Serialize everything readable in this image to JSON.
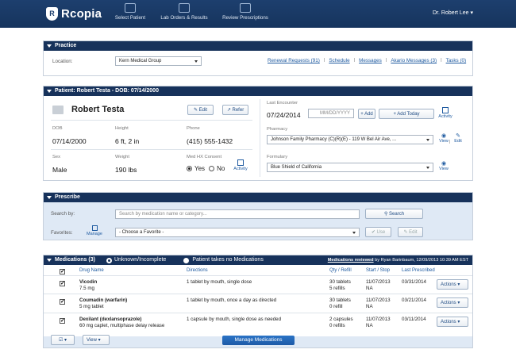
{
  "app": {
    "name": "Rcopia",
    "logo_letter": "R"
  },
  "nav": {
    "select_patient": "Select Patient",
    "lab_orders": "Lab Orders & Results",
    "review_rx": "Review Prescriptions",
    "user": "Dr. Robert Lee ▾"
  },
  "practice": {
    "header": "Practice",
    "location_label": "Location:",
    "location_value": "Kern Medical Group",
    "links": [
      "Renewal Requests (91)",
      "Schedule",
      "Messages",
      "Akario Messages (3)",
      "Tasks (0)"
    ]
  },
  "patient": {
    "header": "Patient: Robert Testa - DOB: 07/14/2000",
    "name": "Robert Testa",
    "edit": "Edit",
    "refer": "Refer",
    "dob_label": "DOB",
    "dob": "07/14/2000",
    "height_label": "Height",
    "height": "6 ft, 2 in",
    "phone_label": "Phone",
    "phone": "(415) 555-1432",
    "sex_label": "Sex",
    "sex": "Male",
    "weight_label": "Weight",
    "weight": "190 lbs",
    "consent_label": "Med HX Consent",
    "consent_yes": "Yes",
    "consent_no": "No",
    "activity": "Activity",
    "last_encounter_label": "Last Encounter",
    "last_encounter": "07/24/2014",
    "date_placeholder": "MM/DD/YYYY",
    "add": "+ Add",
    "add_today": "+ Add Today",
    "pharmacy_label": "Pharmacy",
    "pharmacy": "Johnson Family Pharmacy (C)(R)(E) - 119 W Bel Air Ave, ...",
    "view": "View",
    "edit_small": "Edit",
    "formulary_label": "Formulary",
    "formulary": "Blue Shield of California"
  },
  "prescribe": {
    "header": "Prescribe",
    "search_label": "Search by:",
    "search_placeholder": "Search by medication name or category...",
    "search_btn": "Search",
    "favorites_label": "Favorites:",
    "manage": "Manage",
    "favorite_choice": "- Choose a Favorite -",
    "use": "Use",
    "edit": "Edit"
  },
  "medications": {
    "header": "Medications (3)",
    "opt_unknown": "Unknown/Incomplete",
    "opt_none": "Patient takes no Medications",
    "reviewed_label": "Medications reviewed",
    "reviewed_by": " by Ryan Barinbaum, 12/09/2013 10:39 AM EST",
    "columns": [
      "Drug Name",
      "Directions",
      "Qty / Refill",
      "Start / Stop",
      "Last Prescribed"
    ],
    "rows": [
      {
        "name": "Vicodin",
        "strength": "7.5 mg",
        "directions": "1 tablet by mouth, single dose",
        "qty": "30 tablets",
        "refill": "5 refills",
        "start": "11/07/2013",
        "stop": "NA",
        "last": "03/31/2014",
        "action": "Actions"
      },
      {
        "name": "Coumadin (warfarin)",
        "strength": "5 mg tablet",
        "directions": "1 tablet by mouth, once a day as directed",
        "qty": "30 tablets",
        "refill": "0 refill",
        "start": "11/07/2013",
        "stop": "NA",
        "last": "03/21/2014",
        "action": "Actions"
      },
      {
        "name": "Dexilant (dexlansoprazole)",
        "strength": "60 mg caplet, multiphase delay release",
        "directions": "1 capsule by mouth, single dose as needed",
        "qty": "2 capsules",
        "refill": "0 refills",
        "start": "11/07/2013",
        "stop": "NA",
        "last": "03/11/2014",
        "action": "Actions"
      }
    ],
    "view": "View",
    "manage_btn": "Manage Medications"
  },
  "colors": {
    "navy": "#17325b",
    "accent": "#1e5aa0",
    "primary": "#2b73c6"
  }
}
